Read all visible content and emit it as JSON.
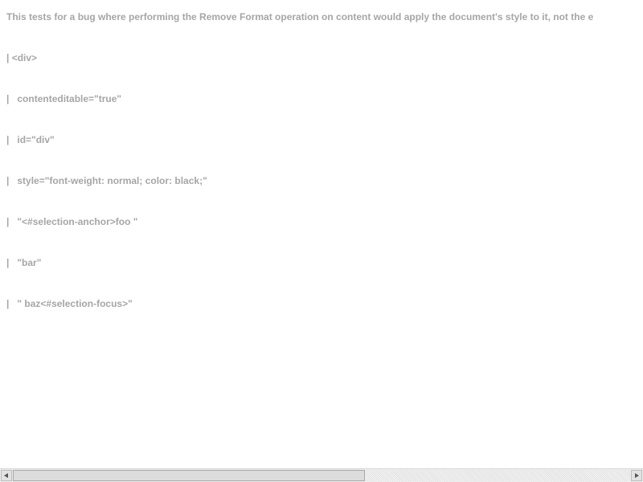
{
  "description": "This tests for a bug where performing the Remove Format operation on content would apply the document's style to it, not the e",
  "dom_dump": [
    "| <div>",
    "|   contenteditable=\"true\"",
    "|   id=\"div\"",
    "|   style=\"font-weight: normal; color: black;\"",
    "|   \"<#selection-anchor>foo \"",
    "|   \"bar\"",
    "|   \" baz<#selection-focus>\""
  ],
  "scrollbar": {
    "horizontal_position": 0.0,
    "visible_fraction": 0.57
  }
}
